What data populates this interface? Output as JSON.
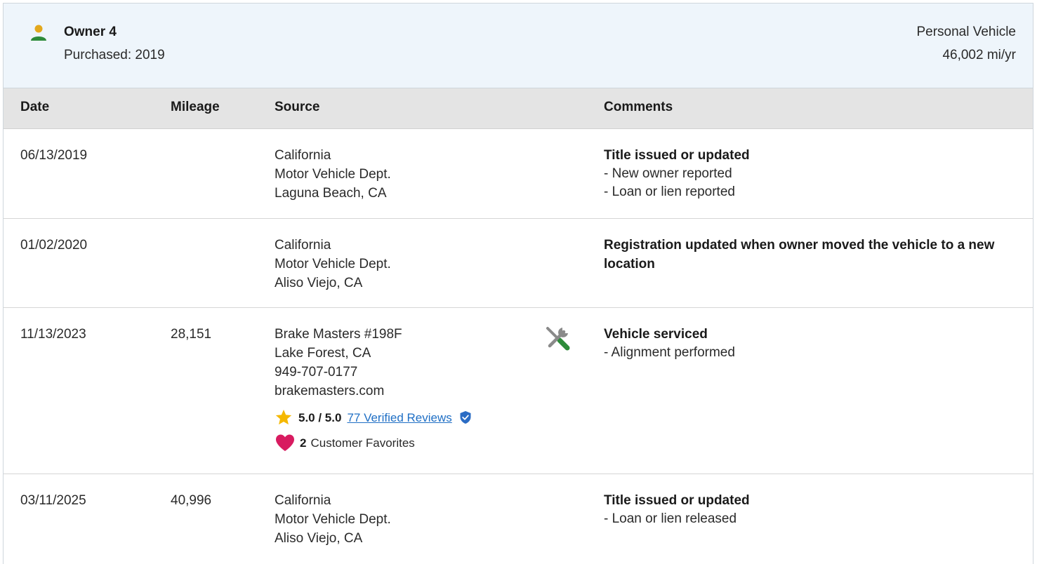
{
  "owner": {
    "name": "Owner 4",
    "purchased": "Purchased: 2019",
    "vehicle_type": "Personal Vehicle",
    "usage_rate": "46,002 mi/yr"
  },
  "columns": {
    "date": "Date",
    "mileage": "Mileage",
    "source": "Source",
    "comments": "Comments"
  },
  "rows": [
    {
      "date": "06/13/2019",
      "mileage": "",
      "source": [
        "California",
        "Motor Vehicle Dept.",
        "Laguna Beach, CA"
      ],
      "comment_title": "Title issued or updated",
      "comment_details": [
        "- New owner reported",
        "- Loan or lien reported"
      ]
    },
    {
      "date": "01/02/2020",
      "mileage": "",
      "source": [
        "California",
        "Motor Vehicle Dept.",
        "Aliso Viejo, CA"
      ],
      "comment_title": "Registration updated when owner moved the vehicle to a new location",
      "comment_details": []
    },
    {
      "date": "11/13/2023",
      "mileage": "28,151",
      "source": [
        "Brake Masters #198F",
        "Lake Forest, CA",
        "949-707-0177",
        "brakemasters.com"
      ],
      "rating": {
        "score": "5.0 / 5.0",
        "reviews_link": "77 Verified Reviews",
        "favorites_count": "2",
        "favorites_label": "Customer Favorites"
      },
      "comment_title": "Vehicle serviced",
      "comment_details": [
        "- Alignment performed"
      ]
    },
    {
      "date": "03/11/2025",
      "mileage": "40,996",
      "source": [
        "California",
        "Motor Vehicle Dept.",
        "Aliso Viejo, CA"
      ],
      "comment_title": "Title issued or updated",
      "comment_details": [
        "- Loan or lien released"
      ]
    }
  ],
  "icons": {
    "owner": "person-icon",
    "service": "tools-icon",
    "star": "star-icon",
    "verified": "shield-check-icon",
    "favorite": "heart-icon"
  },
  "colors": {
    "header_bg": "#eef5fb",
    "table_head_bg": "#e4e4e4",
    "link": "#1f6fc5",
    "owner_icon_head": "#e3a81c",
    "owner_icon_body": "#2e8b3a",
    "star": "#f5b800",
    "heart": "#d81b60",
    "shield": "#2b6cc4"
  }
}
